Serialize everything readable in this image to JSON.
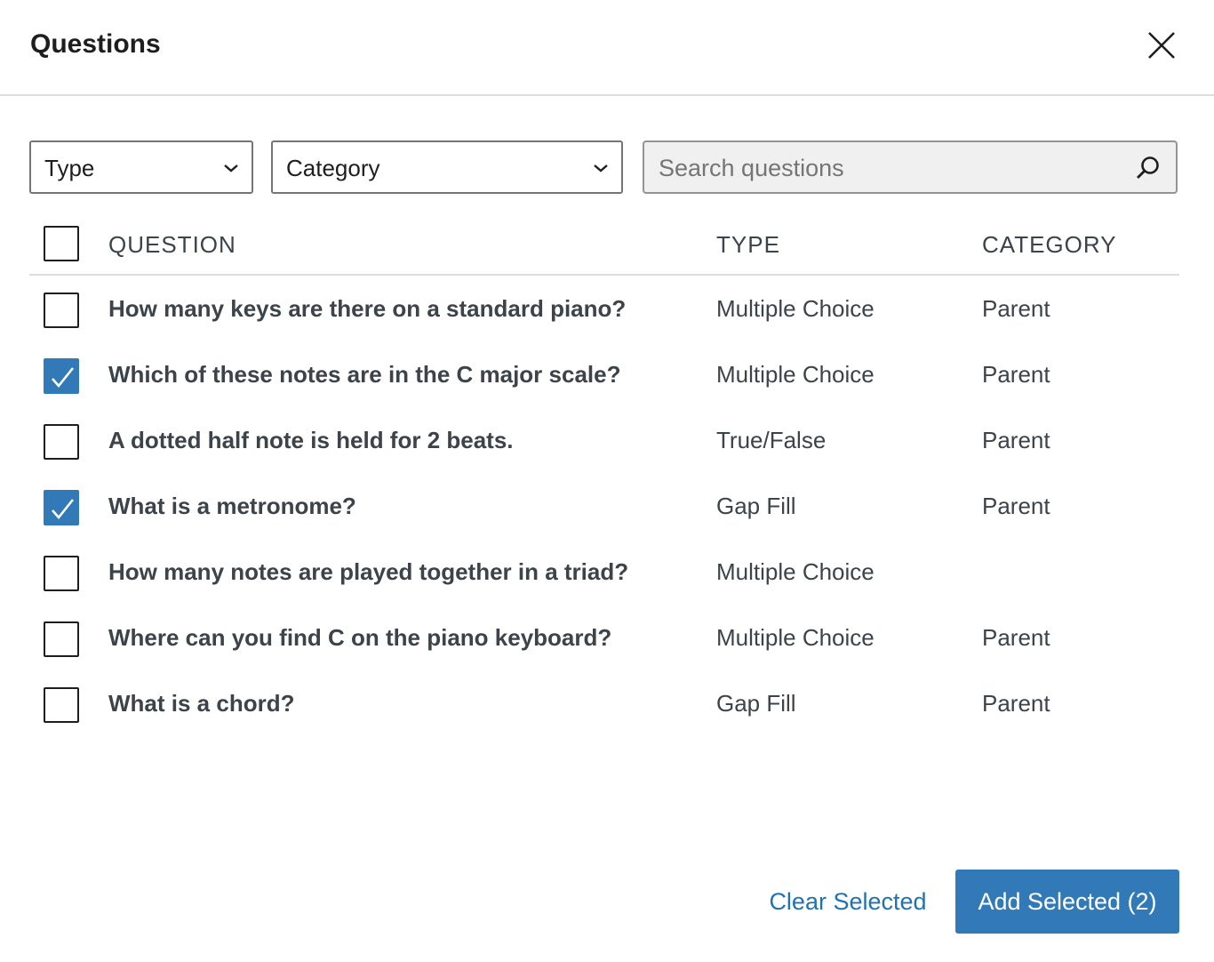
{
  "header": {
    "title": "Questions",
    "close_icon": "close-icon"
  },
  "filters": {
    "type_label": "Type",
    "category_label": "Category",
    "search_placeholder": "Search questions",
    "search_value": ""
  },
  "table": {
    "columns": {
      "question": "QUESTION",
      "type": "TYPE",
      "category": "CATEGORY"
    },
    "select_all_checked": false,
    "rows": [
      {
        "question": "How many keys are there on a standard piano?",
        "type": "Multiple Choice",
        "category": "Parent",
        "checked": false
      },
      {
        "question": "Which of these notes are in the C major scale?",
        "type": "Multiple Choice",
        "category": "Parent",
        "checked": true
      },
      {
        "question": "A dotted half note is held for 2 beats.",
        "type": "True/False",
        "category": "Parent",
        "checked": false
      },
      {
        "question": "What is a metronome?",
        "type": "Gap Fill",
        "category": "Parent",
        "checked": true
      },
      {
        "question": "How many notes are played together in a triad?",
        "type": "Multiple Choice",
        "category": "",
        "checked": false
      },
      {
        "question": "Where can you find C on the piano keyboard?",
        "type": "Multiple Choice",
        "category": "Parent",
        "checked": false
      },
      {
        "question": "What is a chord?",
        "type": "Gap Fill",
        "category": "Parent",
        "checked": false
      }
    ]
  },
  "footer": {
    "clear_label": "Clear Selected",
    "add_label": "Add Selected (2)"
  },
  "colors": {
    "accent": "#3279b7",
    "link": "#2271b1",
    "text": "#1e1e1e",
    "muted_text": "#3c434a",
    "border": "#dcdcde"
  }
}
